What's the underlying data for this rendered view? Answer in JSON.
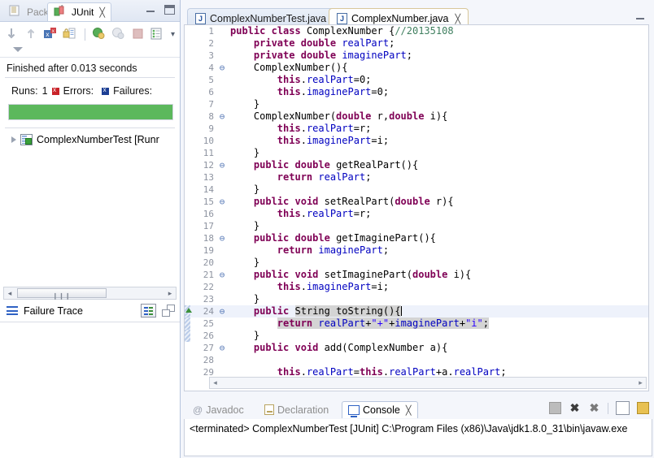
{
  "junit_view": {
    "tabs": [
      {
        "label": "Packag...",
        "icon": "package-explorer-icon",
        "active": false
      },
      {
        "label": "JUnit",
        "icon": "junit-icon",
        "active": true
      }
    ],
    "close_glyph": "╳",
    "window_buttons": [
      "minimize-button",
      "maximize-button"
    ],
    "toolbar": [
      "next-failure-icon",
      "previous-failure-icon",
      "show-failures-only-icon",
      "scroll-lock-icon",
      "rerun-test-icon",
      "rerun-failed-first-icon",
      "stop-icon",
      "test-history-icon"
    ],
    "toolbar_menu_glyph": "▾",
    "view_menu_icon": "view-menu-caret-icon",
    "status_text": "Finished after 0.013 seconds",
    "counters": {
      "runs_label": "Runs:",
      "runs_value": "1",
      "errors_label": "Errors:",
      "errors_value": "",
      "failures_label": "Failures:",
      "failures_value": "",
      "error_marker": "error-square-icon",
      "failure_marker": "failure-square-icon"
    },
    "progress": {
      "percent": 100,
      "color": "#5cb85c"
    },
    "tree": [
      {
        "label": "ComplexNumberTest [Runr",
        "icon": "test-class-icon",
        "twisty": "collapsed"
      }
    ],
    "hscroll": {
      "left_arrow": "◂",
      "right_arrow": "▸",
      "grip": "❙❙❙"
    },
    "failure_trace": {
      "label": "Failure Trace",
      "icon": "failure-trace-icon",
      "buttons": [
        "filter-stack-trace-button",
        "compare-result-button"
      ],
      "body_text": ""
    }
  },
  "editor": {
    "tabs": [
      {
        "label": "ComplexNumberTest.java",
        "active": false,
        "icon": "java-file-icon"
      },
      {
        "label": "ComplexNumber.java",
        "active": true,
        "icon": "java-file-icon"
      }
    ],
    "close_glyph": "╳",
    "minimize_button": "editor-minimize-button",
    "fold_glyph": "⊖",
    "scrollbar": {
      "left_arrow": "◂",
      "right_arrow": "▸"
    },
    "lines": [
      {
        "n": "1",
        "fold": false,
        "diff": false,
        "marker": false,
        "sel": false,
        "tokens": [
          {
            "t": "public",
            "c": "kw"
          },
          {
            "t": " ",
            "c": "pln"
          },
          {
            "t": "class",
            "c": "kw"
          },
          {
            "t": " ComplexNumber {",
            "c": "pln"
          },
          {
            "t": "//20135108",
            "c": "cmt"
          }
        ]
      },
      {
        "n": "2",
        "fold": false,
        "diff": false,
        "marker": false,
        "sel": false,
        "tokens": [
          {
            "t": "    ",
            "c": "pln"
          },
          {
            "t": "private",
            "c": "kw"
          },
          {
            "t": " ",
            "c": "pln"
          },
          {
            "t": "double",
            "c": "kw"
          },
          {
            "t": " ",
            "c": "pln"
          },
          {
            "t": "realPart",
            "c": "fld"
          },
          {
            "t": ";",
            "c": "pln"
          }
        ]
      },
      {
        "n": "3",
        "fold": false,
        "diff": false,
        "marker": false,
        "sel": false,
        "tokens": [
          {
            "t": "    ",
            "c": "pln"
          },
          {
            "t": "private",
            "c": "kw"
          },
          {
            "t": " ",
            "c": "pln"
          },
          {
            "t": "double",
            "c": "kw"
          },
          {
            "t": " ",
            "c": "pln"
          },
          {
            "t": "imaginePart",
            "c": "fld"
          },
          {
            "t": ";",
            "c": "pln"
          }
        ]
      },
      {
        "n": "4",
        "fold": true,
        "diff": false,
        "marker": false,
        "sel": false,
        "tokens": [
          {
            "t": "    ComplexNumber(){",
            "c": "pln"
          }
        ]
      },
      {
        "n": "5",
        "fold": false,
        "diff": false,
        "marker": false,
        "sel": false,
        "tokens": [
          {
            "t": "        ",
            "c": "pln"
          },
          {
            "t": "this",
            "c": "kw"
          },
          {
            "t": ".",
            "c": "pln"
          },
          {
            "t": "realPart",
            "c": "fld"
          },
          {
            "t": "=0;",
            "c": "pln"
          }
        ]
      },
      {
        "n": "6",
        "fold": false,
        "diff": false,
        "marker": false,
        "sel": false,
        "tokens": [
          {
            "t": "        ",
            "c": "pln"
          },
          {
            "t": "this",
            "c": "kw"
          },
          {
            "t": ".",
            "c": "pln"
          },
          {
            "t": "imaginePart",
            "c": "fld"
          },
          {
            "t": "=0;",
            "c": "pln"
          }
        ]
      },
      {
        "n": "7",
        "fold": false,
        "diff": false,
        "marker": false,
        "sel": false,
        "tokens": [
          {
            "t": "    }",
            "c": "pln"
          }
        ]
      },
      {
        "n": "8",
        "fold": true,
        "diff": false,
        "marker": false,
        "sel": false,
        "tokens": [
          {
            "t": "    ComplexNumber(",
            "c": "pln"
          },
          {
            "t": "double",
            "c": "kw"
          },
          {
            "t": " r,",
            "c": "pln"
          },
          {
            "t": "double",
            "c": "kw"
          },
          {
            "t": " i){",
            "c": "pln"
          }
        ]
      },
      {
        "n": "9",
        "fold": false,
        "diff": false,
        "marker": false,
        "sel": false,
        "tokens": [
          {
            "t": "        ",
            "c": "pln"
          },
          {
            "t": "this",
            "c": "kw"
          },
          {
            "t": ".",
            "c": "pln"
          },
          {
            "t": "realPart",
            "c": "fld"
          },
          {
            "t": "=r;",
            "c": "pln"
          }
        ]
      },
      {
        "n": "10",
        "fold": false,
        "diff": false,
        "marker": false,
        "sel": false,
        "tokens": [
          {
            "t": "        ",
            "c": "pln"
          },
          {
            "t": "this",
            "c": "kw"
          },
          {
            "t": ".",
            "c": "pln"
          },
          {
            "t": "imaginePart",
            "c": "fld"
          },
          {
            "t": "=i;",
            "c": "pln"
          }
        ]
      },
      {
        "n": "11",
        "fold": false,
        "diff": false,
        "marker": false,
        "sel": false,
        "tokens": [
          {
            "t": "    }",
            "c": "pln"
          }
        ]
      },
      {
        "n": "12",
        "fold": true,
        "diff": false,
        "marker": false,
        "sel": false,
        "tokens": [
          {
            "t": "    ",
            "c": "pln"
          },
          {
            "t": "public",
            "c": "kw"
          },
          {
            "t": " ",
            "c": "pln"
          },
          {
            "t": "double",
            "c": "kw"
          },
          {
            "t": " getRealPart(){",
            "c": "pln"
          }
        ]
      },
      {
        "n": "13",
        "fold": false,
        "diff": false,
        "marker": false,
        "sel": false,
        "tokens": [
          {
            "t": "        ",
            "c": "pln"
          },
          {
            "t": "return",
            "c": "kw"
          },
          {
            "t": " ",
            "c": "pln"
          },
          {
            "t": "realPart",
            "c": "fld"
          },
          {
            "t": ";",
            "c": "pln"
          }
        ]
      },
      {
        "n": "14",
        "fold": false,
        "diff": false,
        "marker": false,
        "sel": false,
        "tokens": [
          {
            "t": "    }",
            "c": "pln"
          }
        ]
      },
      {
        "n": "15",
        "fold": true,
        "diff": false,
        "marker": false,
        "sel": false,
        "tokens": [
          {
            "t": "    ",
            "c": "pln"
          },
          {
            "t": "public",
            "c": "kw"
          },
          {
            "t": " ",
            "c": "pln"
          },
          {
            "t": "void",
            "c": "kw"
          },
          {
            "t": " setRealPart(",
            "c": "pln"
          },
          {
            "t": "double",
            "c": "kw"
          },
          {
            "t": " r){",
            "c": "pln"
          }
        ]
      },
      {
        "n": "16",
        "fold": false,
        "diff": false,
        "marker": false,
        "sel": false,
        "tokens": [
          {
            "t": "        ",
            "c": "pln"
          },
          {
            "t": "this",
            "c": "kw"
          },
          {
            "t": ".",
            "c": "pln"
          },
          {
            "t": "realPart",
            "c": "fld"
          },
          {
            "t": "=r;",
            "c": "pln"
          }
        ]
      },
      {
        "n": "17",
        "fold": false,
        "diff": false,
        "marker": false,
        "sel": false,
        "tokens": [
          {
            "t": "    }",
            "c": "pln"
          }
        ]
      },
      {
        "n": "18",
        "fold": true,
        "diff": false,
        "marker": false,
        "sel": false,
        "tokens": [
          {
            "t": "    ",
            "c": "pln"
          },
          {
            "t": "public",
            "c": "kw"
          },
          {
            "t": " ",
            "c": "pln"
          },
          {
            "t": "double",
            "c": "kw"
          },
          {
            "t": " getImaginePart(){",
            "c": "pln"
          }
        ]
      },
      {
        "n": "19",
        "fold": false,
        "diff": false,
        "marker": false,
        "sel": false,
        "tokens": [
          {
            "t": "        ",
            "c": "pln"
          },
          {
            "t": "return",
            "c": "kw"
          },
          {
            "t": " ",
            "c": "pln"
          },
          {
            "t": "imaginePart",
            "c": "fld"
          },
          {
            "t": ";",
            "c": "pln"
          }
        ]
      },
      {
        "n": "20",
        "fold": false,
        "diff": false,
        "marker": false,
        "sel": false,
        "tokens": [
          {
            "t": "    }",
            "c": "pln"
          }
        ]
      },
      {
        "n": "21",
        "fold": true,
        "diff": false,
        "marker": false,
        "sel": false,
        "tokens": [
          {
            "t": "    ",
            "c": "pln"
          },
          {
            "t": "public",
            "c": "kw"
          },
          {
            "t": " ",
            "c": "pln"
          },
          {
            "t": "void",
            "c": "kw"
          },
          {
            "t": " setImaginePart(",
            "c": "pln"
          },
          {
            "t": "double",
            "c": "kw"
          },
          {
            "t": " i){",
            "c": "pln"
          }
        ]
      },
      {
        "n": "22",
        "fold": false,
        "diff": false,
        "marker": false,
        "sel": false,
        "tokens": [
          {
            "t": "        ",
            "c": "pln"
          },
          {
            "t": "this",
            "c": "kw"
          },
          {
            "t": ".",
            "c": "pln"
          },
          {
            "t": "imaginePart",
            "c": "fld"
          },
          {
            "t": "=i;",
            "c": "pln"
          }
        ]
      },
      {
        "n": "23",
        "fold": false,
        "diff": false,
        "marker": false,
        "sel": false,
        "tokens": [
          {
            "t": "    }",
            "c": "pln"
          }
        ]
      },
      {
        "n": "24",
        "fold": true,
        "diff": true,
        "marker": true,
        "sel": true,
        "hl": true,
        "caret": true,
        "tokens": [
          {
            "t": "    ",
            "c": "pln"
          },
          {
            "t": "public",
            "c": "kw"
          },
          {
            "t": " ",
            "c": "pln"
          },
          {
            "t": "String toString(){",
            "c": "pln sel"
          }
        ]
      },
      {
        "n": "25",
        "fold": false,
        "diff": true,
        "marker": false,
        "sel": true,
        "hl": false,
        "tokens": [
          {
            "t": "        ",
            "c": "pln"
          },
          {
            "t": "return",
            "c": "kw sel"
          },
          {
            "t": " ",
            "c": "pln sel"
          },
          {
            "t": "realPart",
            "c": "fld sel"
          },
          {
            "t": "+",
            "c": "pln sel"
          },
          {
            "t": "\"+\"",
            "c": "str sel"
          },
          {
            "t": "+",
            "c": "pln sel"
          },
          {
            "t": "imaginePart",
            "c": "fld sel"
          },
          {
            "t": "+",
            "c": "pln sel"
          },
          {
            "t": "\"i\"",
            "c": "str sel"
          },
          {
            "t": ";",
            "c": "pln sel"
          }
        ]
      },
      {
        "n": "26",
        "fold": false,
        "diff": true,
        "marker": false,
        "sel": false,
        "tokens": [
          {
            "t": "    }",
            "c": "pln"
          }
        ]
      },
      {
        "n": "27",
        "fold": true,
        "diff": false,
        "marker": false,
        "sel": false,
        "tokens": [
          {
            "t": "    ",
            "c": "pln"
          },
          {
            "t": "public",
            "c": "kw"
          },
          {
            "t": " ",
            "c": "pln"
          },
          {
            "t": "void",
            "c": "kw"
          },
          {
            "t": " add(ComplexNumber a){",
            "c": "pln"
          }
        ]
      },
      {
        "n": "28",
        "fold": false,
        "diff": false,
        "marker": false,
        "sel": false,
        "tokens": [
          {
            "t": "",
            "c": "pln"
          }
        ]
      },
      {
        "n": "29",
        "fold": false,
        "diff": false,
        "marker": false,
        "sel": false,
        "tokens": [
          {
            "t": "        ",
            "c": "pln"
          },
          {
            "t": "this",
            "c": "kw"
          },
          {
            "t": ".",
            "c": "pln"
          },
          {
            "t": "realPart",
            "c": "fld"
          },
          {
            "t": "=",
            "c": "pln"
          },
          {
            "t": "this",
            "c": "kw"
          },
          {
            "t": ".",
            "c": "pln"
          },
          {
            "t": "realPart",
            "c": "fld"
          },
          {
            "t": "+a.",
            "c": "pln"
          },
          {
            "t": "realPart",
            "c": "fld"
          },
          {
            "t": ";",
            "c": "pln"
          }
        ]
      }
    ]
  },
  "bottom_panel": {
    "tabs": [
      {
        "label": "Javadoc",
        "active": false,
        "icon": "javadoc-icon"
      },
      {
        "label": "Declaration",
        "active": false,
        "icon": "declaration-icon"
      },
      {
        "label": "Console",
        "active": true,
        "icon": "console-icon"
      }
    ],
    "close_glyph": "╳",
    "toolbar": [
      "terminate-icon",
      "remove-launch-icon",
      "remove-all-terminated-icon",
      "open-console-icon",
      "pin-console-icon"
    ],
    "console_text": "<terminated> ComplexNumberTest [JUnit] C:\\Program Files (x86)\\Java\\jdk1.8.0_31\\bin\\javaw.exe"
  }
}
